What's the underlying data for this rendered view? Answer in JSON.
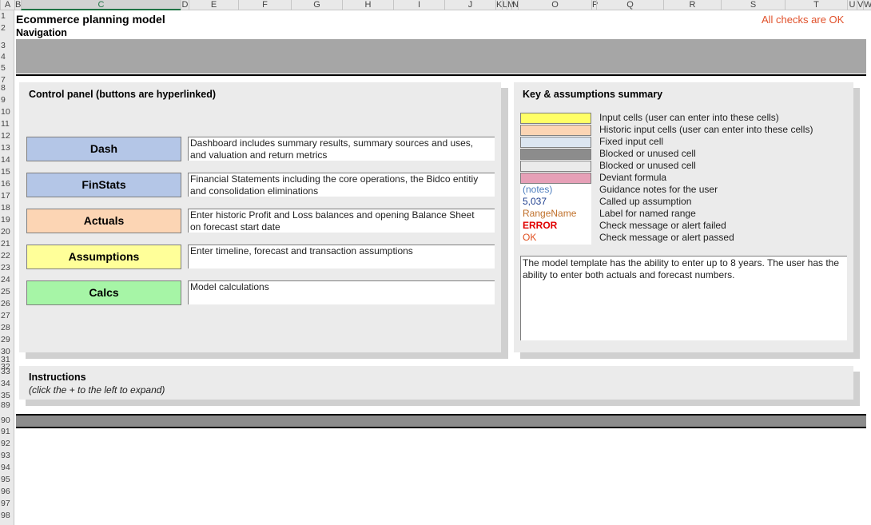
{
  "columns": [
    "A",
    "B",
    "C",
    "D",
    "E",
    "F",
    "G",
    "H",
    "I",
    "J",
    "K",
    "L",
    "M",
    "N",
    "O",
    "P",
    "Q",
    "R",
    "S",
    "T",
    "U",
    "V",
    "W"
  ],
  "rows": [
    "1",
    "2",
    "3",
    "4",
    "5",
    "7",
    "8",
    "9",
    "10",
    "11",
    "12",
    "13",
    "14",
    "15",
    "16",
    "17",
    "18",
    "19",
    "20",
    "21",
    "22",
    "23",
    "24",
    "25",
    "26",
    "27",
    "28",
    "29",
    "30",
    "31",
    "32",
    "33",
    "34",
    "35",
    "89",
    "90",
    "91",
    "92",
    "93",
    "94",
    "95",
    "96",
    "97",
    "98"
  ],
  "title": "Ecommerce planning model",
  "subtitle": "Navigation",
  "check_status": "All checks are OK",
  "control_panel": {
    "heading": "Control panel (buttons are hyperlinked)",
    "buttons": [
      {
        "label": "Dash",
        "color": "#b4c6e7",
        "desc1": "Dashboard includes summary results, summary sources and uses,",
        "desc2": "and valuation and return metrics"
      },
      {
        "label": "FinStats",
        "color": "#b4c6e7",
        "desc1": "Financial Statements including the core operations, the Bidco entitiy",
        "desc2": "and consolidation eliminations"
      },
      {
        "label": "Actuals",
        "color": "#fcd5b4",
        "desc1": "Enter historic Profit and Loss balances and opening Balance Sheet",
        "desc2": "on forecast start date"
      },
      {
        "label": "Assumptions",
        "color": "#ffff99",
        "desc1": "Enter timeline, forecast and transaction assumptions",
        "desc2": ""
      },
      {
        "label": "Calcs",
        "color": "#a6f5a6",
        "desc1": "Model calculations",
        "desc2": ""
      }
    ]
  },
  "key": {
    "heading": "Key & assumptions summary",
    "items": [
      {
        "label": "",
        "label_color": "",
        "fill": "#ffff66",
        "text": "Input cells (user can enter into these cells)"
      },
      {
        "label": "",
        "label_color": "",
        "fill": "#fcd5b4",
        "text": "Historic input cells (user can enter into these cells)"
      },
      {
        "label": "",
        "label_color": "",
        "fill": "#dce6f1",
        "text": "Fixed input cell"
      },
      {
        "label": "",
        "label_color": "",
        "fill": "#8c8c8c",
        "text": "Blocked or unused cell"
      },
      {
        "label": "",
        "label_color": "",
        "fill": "#ebebeb",
        "text": "Blocked or unused cell"
      },
      {
        "label": "",
        "label_color": "",
        "fill": "#e6a0b7",
        "text": "Deviant formula"
      },
      {
        "label": "(notes)",
        "label_color": "#4f7fbf",
        "fill": "",
        "text": "Guidance notes for the user"
      },
      {
        "label": "5,037",
        "label_color": "#1f3f8f",
        "fill": "",
        "text": "Called up assumption"
      },
      {
        "label": "RangeName",
        "label_color": "#c0702a",
        "fill": "",
        "text": "Label for named range"
      },
      {
        "label": "ERROR",
        "label_color": "#e00000",
        "fill": "",
        "text": "Check message or alert failed"
      },
      {
        "label": "OK",
        "label_color": "#e05020",
        "fill": "",
        "text": "Check message or alert passed"
      }
    ],
    "note": "The model template has the ability to enter up to 8 years. The user has the ability to enter both actuals and forecast numbers."
  },
  "instructions": {
    "heading": "Instructions",
    "sub": "(click the + to the left to expand)"
  }
}
